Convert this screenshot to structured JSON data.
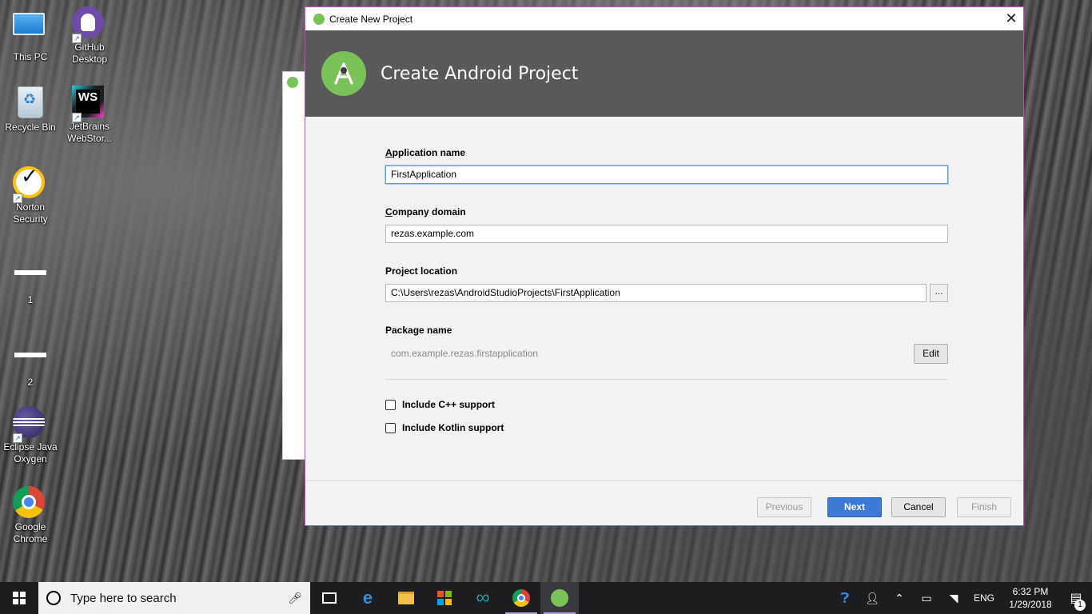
{
  "desktop": {
    "icons": [
      {
        "label": "This PC"
      },
      {
        "label": "GitHub Desktop"
      },
      {
        "label": "Recycle Bin"
      },
      {
        "label": "JetBrains WebStor..."
      },
      {
        "label": "Norton Security"
      },
      {
        "label": "1"
      },
      {
        "label": "2"
      },
      {
        "label": "Eclipse Java Oxygen"
      },
      {
        "label": "Google Chrome"
      }
    ]
  },
  "dialog": {
    "window_title": "Create New Project",
    "close_glyph": "✕",
    "heading": "Create Android Project",
    "application_name": {
      "label_mnemonic": "A",
      "label_rest": "pplication name",
      "value": "FirstApplication"
    },
    "company_domain": {
      "label_mnemonic": "C",
      "label_rest": "ompany domain",
      "value": "rezas.example.com"
    },
    "project_location": {
      "label": "Project location",
      "value": "C:\\Users\\rezas\\AndroidStudioProjects\\FirstApplication",
      "browse_label": "..."
    },
    "package_name": {
      "label": "Package name",
      "value": "com.example.rezas.firstapplication",
      "edit_label": "Edit"
    },
    "options": [
      {
        "label": "Include C++ support",
        "checked": false
      },
      {
        "label": "Include Kotlin support",
        "checked": false
      }
    ],
    "buttons": {
      "previous": "Previous",
      "next": "Next",
      "cancel": "Cancel",
      "finish": "Finish"
    },
    "colors": {
      "banner": "#595959",
      "accent_border": "#c74ab8",
      "primary_button": "#3d7ad6",
      "android_green": "#78c257"
    }
  },
  "taskbar": {
    "search_placeholder": "Type here to search",
    "apps": [
      {
        "icon": "task-view-icon"
      },
      {
        "icon": "edge-icon"
      },
      {
        "icon": "file-explorer-icon"
      },
      {
        "icon": "store-icon"
      },
      {
        "icon": "arduino-icon"
      },
      {
        "icon": "chrome-icon"
      },
      {
        "icon": "android-studio-icon"
      }
    ],
    "language": "ENG",
    "time": "6:32 PM",
    "date": "1/29/2018",
    "notification_count": "1"
  }
}
